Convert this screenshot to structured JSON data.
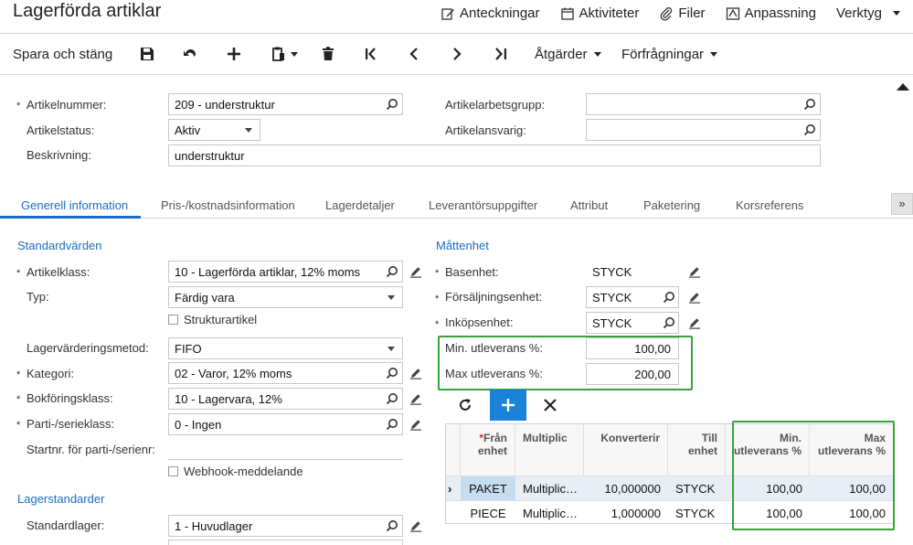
{
  "header": {
    "title": "Lagerförda artiklar",
    "links": [
      "Anteckningar",
      "Aktiviteter",
      "Filer",
      "Anpassning",
      "Verktyg"
    ]
  },
  "toolbar": {
    "save_close": "Spara och stäng",
    "actions": "Åtgärder",
    "inquiries": "Förfrågningar"
  },
  "summary": {
    "item_number_label": "Artikelnummer:",
    "item_number_value": "209 - understruktur",
    "status_label": "Artikelstatus:",
    "status_value": "Aktiv",
    "description_label": "Beskrivning:",
    "description_value": "understruktur",
    "workgroup_label": "Artikelarbetsgrupp:",
    "workgroup_value": "",
    "owner_label": "Artikelansvarig:",
    "owner_value": ""
  },
  "tabs": [
    "Generell information",
    "Pris-/kostnadsinformation",
    "Lagerdetaljer",
    "Leverantörsuppgifter",
    "Attribut",
    "Paketering",
    "Korsreferens"
  ],
  "tab_more": "»",
  "defaults": {
    "title": "Standardvärden",
    "item_class_label": "Artikelklass:",
    "item_class_value": "10 - Lagerförda artiklar, 12% moms",
    "type_label": "Typ:",
    "type_value": "Färdig vara",
    "structure_label": "Strukturartikel",
    "valuation_label": "Lagervärderingsmetod:",
    "valuation_value": "FIFO",
    "category_label": "Kategori:",
    "category_value": "02 - Varor, 12% moms",
    "posting_label": "Bokföringsklass:",
    "posting_value": "10 - Lagervara, 12%",
    "lot_label": "Parti-/serieklass:",
    "lot_value": "0 - Ingen",
    "start_no_label": "Startnr. för parti-/serienr:",
    "webhook_label": "Webhook-meddelande"
  },
  "warehouse": {
    "title": "Lagerstandarder",
    "default_label": "Standardlager:",
    "default_value": "1 - Huvudlager"
  },
  "uom": {
    "title": "Måttenhet",
    "base_label": "Basenhet:",
    "base_value": "STYCK",
    "sales_label": "Försäljningsenhet:",
    "sales_value": "STYCK",
    "purchase_label": "Inköpsenhet:",
    "purchase_value": "STYCK",
    "min_label": "Min. utleverans %:",
    "min_value": "100,00",
    "max_label": "Max utleverans %:",
    "max_value": "200,00"
  },
  "grid": {
    "headers": {
      "from": "Från enhet",
      "multiply": "Multiplic",
      "conversion": "Konverterir",
      "to": "Till enhet",
      "min": "Min. utleverans %",
      "max": "Max utleverans %"
    },
    "rows": [
      {
        "from": "PAKET",
        "multiply": "Multiplic…",
        "conversion": "10,000000",
        "to": "STYCK",
        "min": "100,00",
        "max": "100,00"
      },
      {
        "from": "PIECE",
        "multiply": "Multiplic…",
        "conversion": "1,000000",
        "to": "STYCK",
        "min": "100,00",
        "max": "100,00"
      }
    ]
  },
  "colors": {
    "accent": "#1a6dc0",
    "highlight_box": "#3aa23a",
    "add_button": "#1a82d8"
  }
}
